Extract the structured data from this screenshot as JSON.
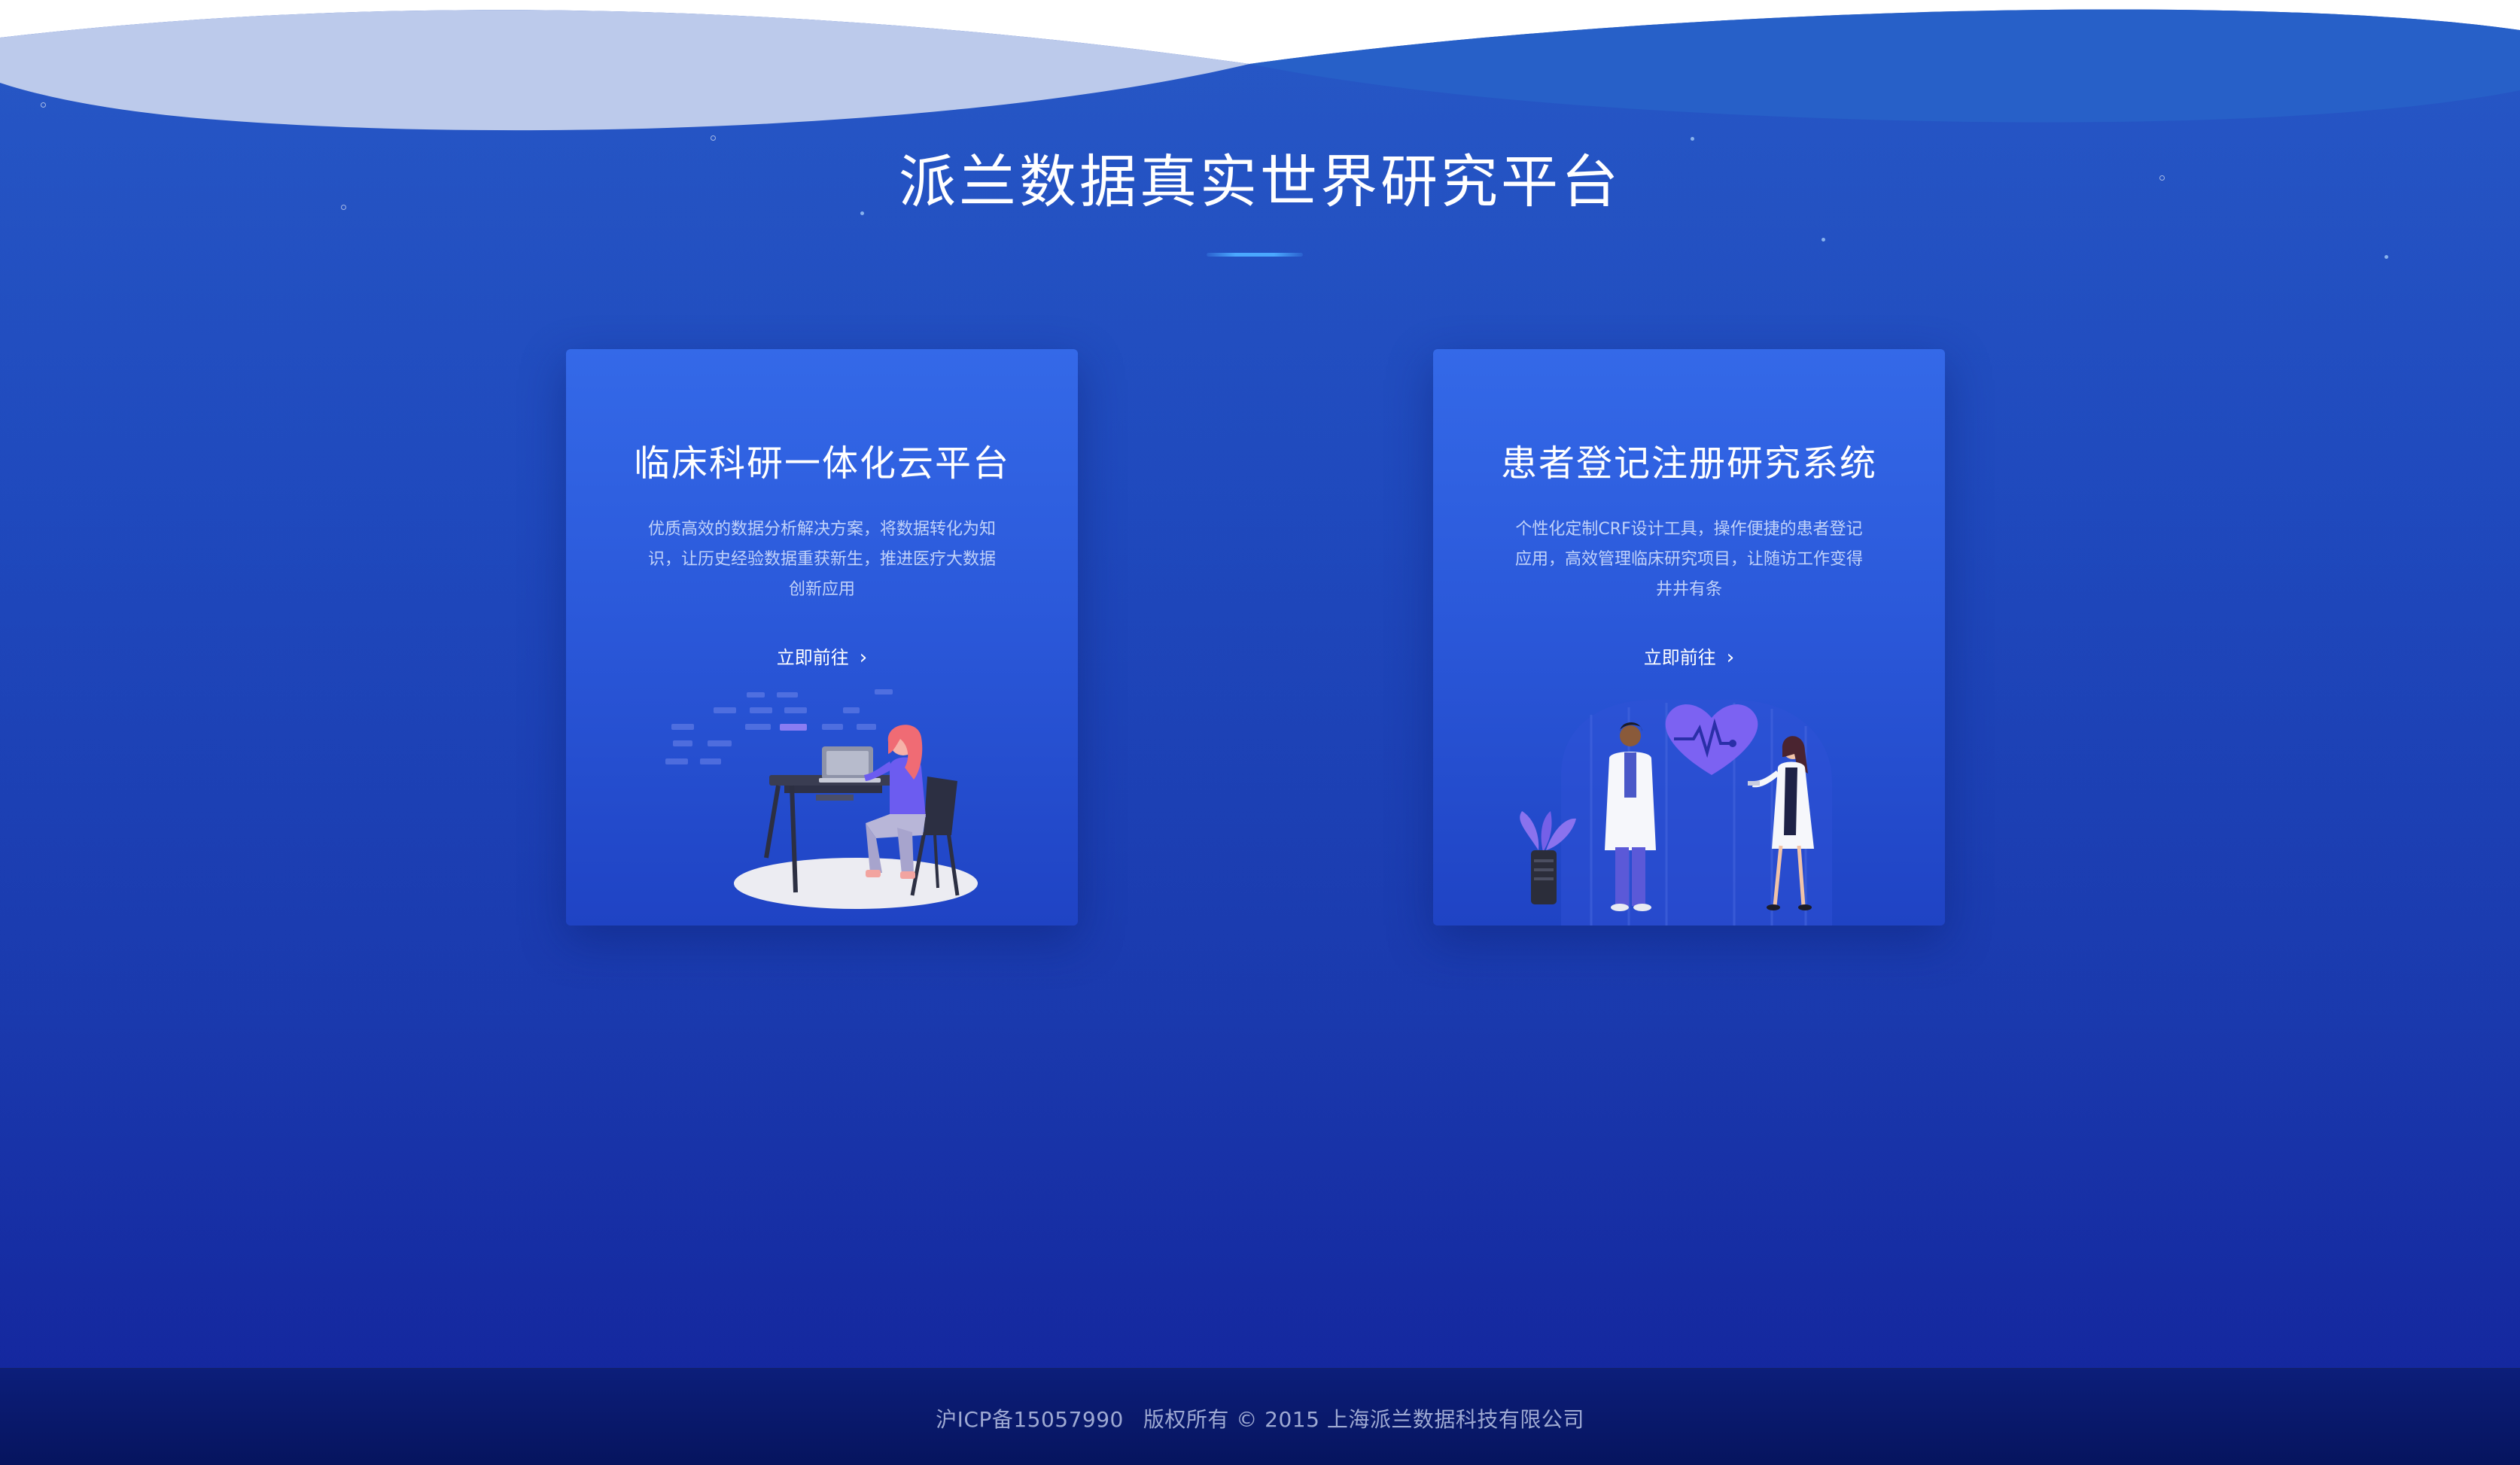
{
  "header": {
    "title": "派兰数据真实世界研究平台"
  },
  "cards": [
    {
      "title": "临床科研一体化云平台",
      "description": "优质高效的数据分析解决方案，将数据转化为知识，让历史经验数据重获新生，推进医疗大数据创新应用",
      "link_label": "立即前往"
    },
    {
      "title": "患者登记注册研究系统",
      "description": "个性化定制CRF设计工具，操作便捷的患者登记应用，高效管理临床研究项目，让随访工作变得井井有条",
      "link_label": "立即前往"
    }
  ],
  "footer": {
    "icp": "沪ICP备15057990",
    "copyright": "版权所有 © 2015 上海派兰数据科技有限公司"
  },
  "colors": {
    "background_top": "#2758c6",
    "background_bottom": "#13239b",
    "card_top": "#3469e8",
    "accent_line": "#4aa8ff",
    "footer": "#06145e"
  }
}
